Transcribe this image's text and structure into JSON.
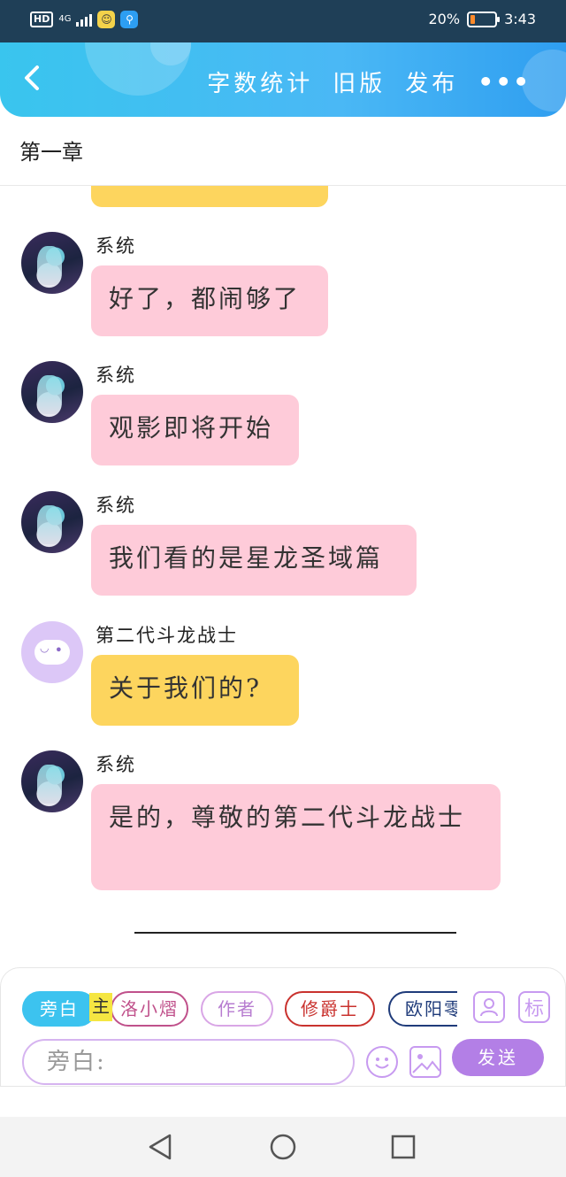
{
  "status_bar": {
    "hd": "HD",
    "network": "4G",
    "battery_percent": "20%",
    "time": "3:43",
    "battery_level": 0.2
  },
  "header": {
    "actions": [
      "字数统计",
      "旧版",
      "发布"
    ],
    "more": "•••"
  },
  "chapter_title": "第一章",
  "messages": [
    {
      "sender": "系统",
      "text": "好了，都闹够了",
      "avatar": "anime-avatar-icon",
      "color": "#fecbd9"
    },
    {
      "sender": "系统",
      "text": "观影即将开始",
      "avatar": "anime-avatar-icon",
      "color": "#fecbd9"
    },
    {
      "sender": "系统",
      "text": "我们看的是星龙圣域篇",
      "avatar": "anime-avatar-icon",
      "color": "#fecbd9"
    },
    {
      "sender": "第二代斗龙战士",
      "text": "关于我们的?",
      "avatar": "robot-avatar-icon",
      "color": "#fdd55e"
    },
    {
      "sender": "系统",
      "text": "是的，尊敬的第二代斗龙战士",
      "avatar": "anime-avatar-icon",
      "color": "#fecbd9"
    }
  ],
  "composer": {
    "role_tabs": [
      "旁白",
      "洛小熠",
      "作者",
      "修爵士",
      "欧阳零"
    ],
    "main_tag": "主",
    "person_icon": "person-icon",
    "tag_button": "标",
    "input_placeholder": "旁白:",
    "send_label": "发送"
  },
  "colors": {
    "header_accent": "#3cc3ef",
    "pink_bubble": "#fecbd9",
    "yellow_bubble": "#fdd55e",
    "send_button": "#b37fe6"
  }
}
